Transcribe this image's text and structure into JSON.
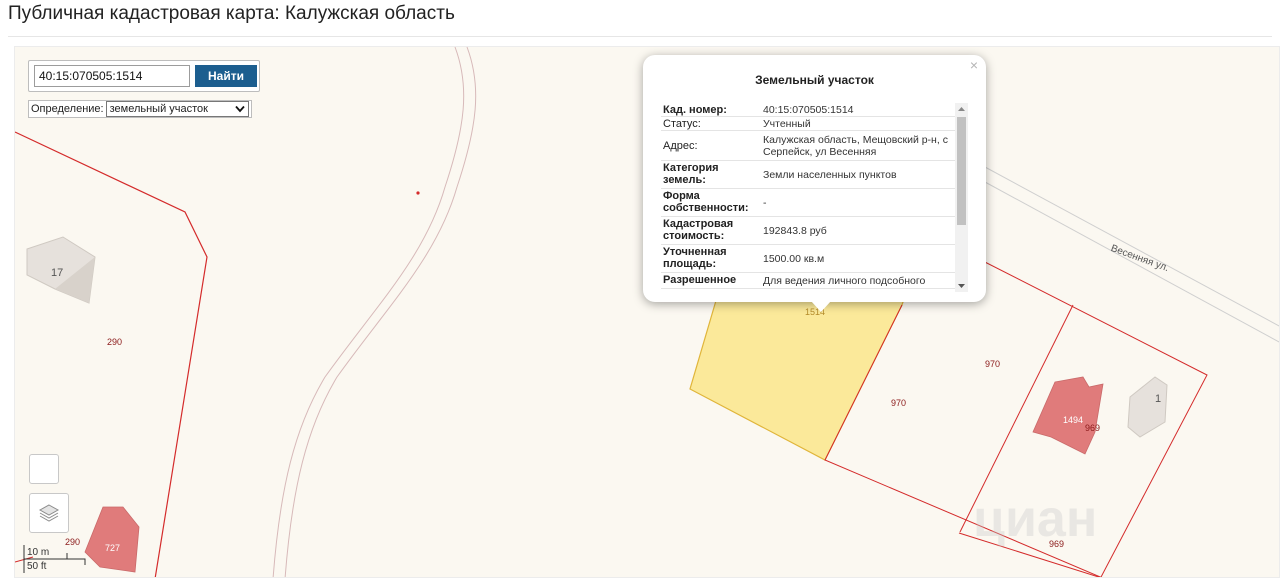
{
  "page": {
    "title": "Публичная кадастровая карта: Калужская область"
  },
  "search": {
    "value": "40:15:070505:1514",
    "button_label": "Найти",
    "definition_label": "Определение:",
    "definition_selected": "земельный участок"
  },
  "scale": {
    "metric": "10 m",
    "imperial": "50 ft"
  },
  "map_labels": {
    "parcel_290_a": "290",
    "parcel_290_b": "290",
    "parcel_727": "727",
    "parcel_1514": "1514",
    "parcel_970_a": "970",
    "parcel_970_b": "970",
    "parcel_1494": "1494",
    "parcel_969_a": "969",
    "parcel_969_b": "969",
    "house_17": "17",
    "house_1": "1",
    "street": "Весенняя ул."
  },
  "popup": {
    "title": "Земельный участок",
    "close": "×",
    "rows": [
      {
        "key": "Кад. номер:",
        "value": "40:15:070505:1514",
        "bold": true
      },
      {
        "key": "Статус:",
        "value": "Учтенный",
        "bold": false
      },
      {
        "key": "Адрес:",
        "value": "Калужская область, Мещовский р-н, с Серпейск, ул Весенняя",
        "bold": false
      },
      {
        "key": "Категория земель:",
        "value": "Земли населенных пунктов",
        "bold": true
      },
      {
        "key": "Форма собственности:",
        "value": "-",
        "bold": true
      },
      {
        "key": "Кадастровая стоимость:",
        "value": "192843.8 руб",
        "bold": true
      },
      {
        "key": "Уточненная площадь:",
        "value": "1500.00 кв.м",
        "bold": true
      },
      {
        "key": "Разрешенное",
        "value": "Для ведения личного подсобного",
        "bold": true
      }
    ]
  },
  "colors": {
    "parcel_line": "#d42b2b",
    "selected_fill": "#fbe99a",
    "selected_stroke": "#e0b53a",
    "building": "#e07b7b",
    "button": "#1c5e8f"
  }
}
